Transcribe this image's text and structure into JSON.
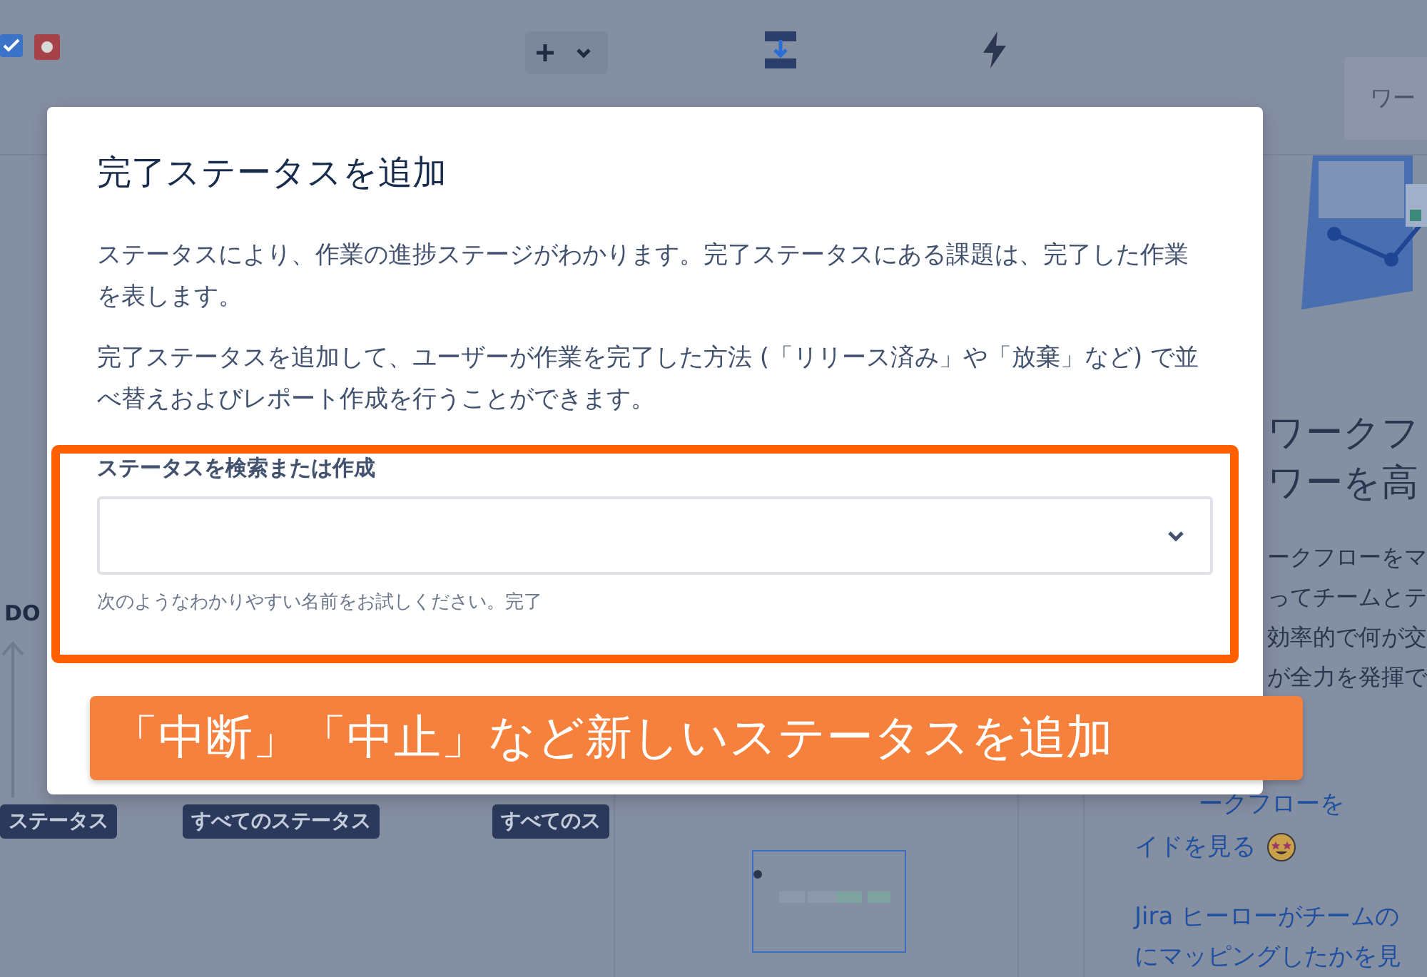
{
  "toolbar": {
    "search": {
      "placeholder": "ワー"
    }
  },
  "canvas": {
    "node_label": "DO",
    "badges": [
      "ステータス",
      "すべてのステータス",
      "すべてのス"
    ]
  },
  "side_panel": {
    "heading_lines": [
      "ワークフ",
      "ワーを高"
    ],
    "paragraph_lines": [
      "ークフローをマ",
      "ってチームとテ",
      "効率的で何が交",
      "が全力を発揮で"
    ],
    "links": [
      "ークフローを",
      "イドを見る"
    ],
    "link_paragraph": [
      "Jira ヒーローがチームの",
      "にマッピングしたかを見"
    ]
  },
  "dialog": {
    "title": "完了ステータスを追加",
    "paragraphs": [
      "ステータスにより、作業の進捗ステージがわかります。完了ステータスにある課題は、完了した作業を表します。",
      "完了ステータスを追加して、ユーザーが作業を完了した方法 (「リリース済み」や「放棄」など) で並べ替えおよびレポート作成を行うことができます。"
    ],
    "field": {
      "label": "ステータスを検索または作成",
      "helper": "次のようなわかりやすい名前をお試しください。完了"
    }
  },
  "annotation": {
    "callout": "「中断」「中止」など新しいステータスを追加"
  }
}
